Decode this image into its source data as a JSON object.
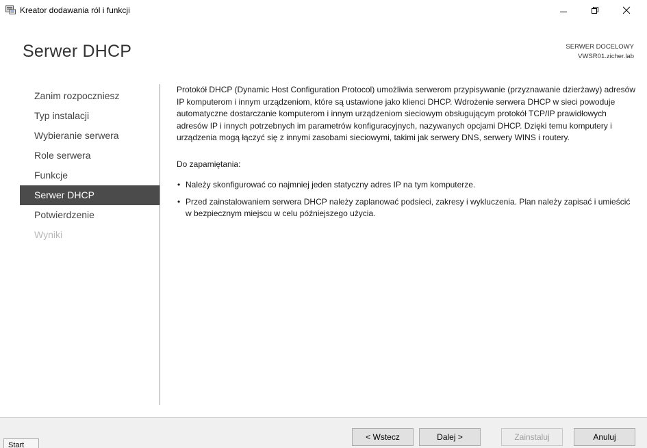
{
  "window": {
    "title": "Kreator dodawania ról i funkcji",
    "icons": {
      "app": "server-manager-icon",
      "minimize": "minimize-icon",
      "maximize": "maximize-icon",
      "close": "close-icon"
    }
  },
  "header": {
    "page_title": "Serwer DHCP",
    "destination_label": "SERWER DOCELOWY",
    "destination_server": "VWSR01.zicher.lab"
  },
  "nav": {
    "items": [
      {
        "label": "Zanim rozpoczniesz",
        "state": "normal"
      },
      {
        "label": "Typ instalacji",
        "state": "normal"
      },
      {
        "label": "Wybieranie serwera",
        "state": "normal"
      },
      {
        "label": "Role serwera",
        "state": "normal"
      },
      {
        "label": "Funkcje",
        "state": "normal"
      },
      {
        "label": "Serwer DHCP",
        "state": "active"
      },
      {
        "label": "Potwierdzenie",
        "state": "normal"
      },
      {
        "label": "Wyniki",
        "state": "disabled"
      }
    ]
  },
  "content": {
    "description": "Protokół DHCP (Dynamic Host Configuration Protocol) umożliwia serwerom przypisywanie (przyznawanie dzierżawy) adresów IP komputerom i innym urządzeniom, które są ustawione jako klienci DHCP. Wdrożenie serwera DHCP w sieci powoduje automatyczne dostarczanie komputerom i innym urządzeniom sieciowym obsługującym protokół TCP/IP prawidłowych adresów IP i innych potrzebnych im parametrów konfiguracyjnych, nazywanych opcjami DHCP. Dzięki temu komputery i urządzenia mogą łączyć się z innymi zasobami sieciowymi, takimi jak serwery DNS, serwery WINS i routery.",
    "remember_heading": "Do zapamiętania:",
    "bullets": [
      "Należy skonfigurować co najmniej jeden statyczny adres IP na tym komputerze.",
      "Przed zainstalowaniem serwera DHCP należy zaplanować podsieci, zakresy i wykluczenia. Plan należy zapisać i umieścić w bezpiecznym miejscu w celu późniejszego użycia."
    ]
  },
  "footer": {
    "back_label": "< Wstecz",
    "next_label": "Dalej >",
    "install_label": "Zainstaluj",
    "cancel_label": "Anuluj",
    "install_enabled": false
  },
  "taskbar": {
    "start_label": "Start"
  },
  "colors": {
    "nav_active_bg": "#4b4b4b",
    "nav_active_text": "#ffffff",
    "nav_disabled_text": "#b8b8b8",
    "footer_bg": "#f0f0f0"
  }
}
